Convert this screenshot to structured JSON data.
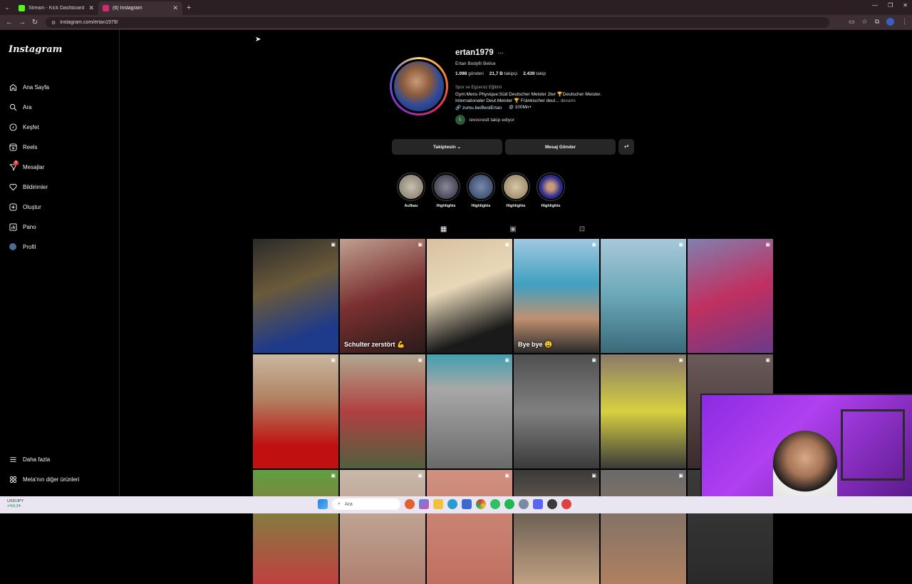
{
  "browser": {
    "tabs": [
      {
        "title": "Stream - Kick Dashboard",
        "favicon_color": "#53fc18",
        "active": false
      },
      {
        "title": "(6) Instagram",
        "favicon_color": "#d62976",
        "active": true
      }
    ],
    "url": "instagram.com/ertan1979/"
  },
  "sidebar": {
    "logo": "Instagram",
    "items": [
      {
        "label": "Ana Sayfa",
        "icon": "home-icon"
      },
      {
        "label": "Ara",
        "icon": "search-icon"
      },
      {
        "label": "Keşfet",
        "icon": "compass-icon"
      },
      {
        "label": "Reels",
        "icon": "reels-icon"
      },
      {
        "label": "Mesajlar",
        "icon": "messenger-icon",
        "badge": "6"
      },
      {
        "label": "Bildirimler",
        "icon": "heart-icon"
      },
      {
        "label": "Oluştur",
        "icon": "plus-square-icon"
      },
      {
        "label": "Pano",
        "icon": "dashboard-icon"
      },
      {
        "label": "Profil",
        "icon": "profile-avatar-icon"
      }
    ],
    "more": "Daha fazla",
    "meta": "Meta'nın diğer ürünleri"
  },
  "profile": {
    "username": "ertan1979",
    "full_name": "Ertan Bodyfit Belice",
    "posts": "1.098",
    "posts_label": "gönderi",
    "followers": "21,7 B",
    "followers_label": "takipçi",
    "following": "2.439",
    "following_label": "takip",
    "category": "Spor ve Egzersiz Eğitimi",
    "bio_line1": "Gym:Mens Physique:Süd Deutscher Meister 2ter 🏆Deutscher Meister.",
    "bio_line2": "Internationaler Deut.Meister 🏆 Fränkischer deut...",
    "bio_more": "devamı",
    "link1": "zumu.be/BestErtan",
    "link2": "100Mn+",
    "followed_by": "levocrestt takip ediyor"
  },
  "actions": {
    "following_button": "Takiptesin ⌄",
    "message_button": "Mesaj Gönder",
    "add_user": "+⁰"
  },
  "highlights": [
    {
      "label": "Aufbau",
      "color": "#9a9486"
    },
    {
      "label": "Highlights",
      "color": "#5a5a6a"
    },
    {
      "label": "Highlights",
      "color": "#4a5a7a"
    },
    {
      "label": "Highlights",
      "color": "#b0a08a"
    },
    {
      "label": "Highlights",
      "color": "#3a3a8a"
    }
  ],
  "posts": [
    {
      "bg": "linear-gradient(160deg,#2a2a2a,#6a5a3a 40%,#1e3a8a 80%)",
      "caption": ""
    },
    {
      "bg": "linear-gradient(160deg,#c0a090,#7a3030 50%,#2a1a1a)",
      "caption": "Schulter zerstört 💪"
    },
    {
      "bg": "linear-gradient(160deg,#d8c0a0,#e8d8b8 40%,#1a1a1a 80%)",
      "caption": ""
    },
    {
      "bg": "linear-gradient(180deg,#a0c8e0,#40a0c0 40%,#c09070 70%,#2a2a2a)",
      "caption": "Bye bye 😩"
    },
    {
      "bg": "linear-gradient(180deg,#a8c8d8,#6aa8b8 50%,#3a6a7a)",
      "caption": ""
    },
    {
      "bg": "linear-gradient(160deg,#8080b0,#c03060 50%,#6a3a8a)",
      "caption": ""
    },
    {
      "bg": "linear-gradient(180deg,#c8b8a0,#b08060 40%,#c01010 80%)",
      "caption": ""
    },
    {
      "bg": "linear-gradient(180deg,#b0a890,#b04040 50%,#506040)",
      "caption": ""
    },
    {
      "bg": "linear-gradient(180deg,#40a0b0,#a8a8a8 30%,#6a6a6a)",
      "caption": ""
    },
    {
      "bg": "linear-gradient(180deg,#505050,#808080 50%,#3a3a3a)",
      "caption": ""
    },
    {
      "bg": "linear-gradient(180deg,#8a7a6a,#d8d040 50%,#3a3a3a)",
      "caption": ""
    },
    {
      "bg": "linear-gradient(180deg,#6a5a5a,#3a2a2a)",
      "caption": ""
    },
    {
      "bg": "linear-gradient(180deg,#60a040,#c04040)",
      "caption": ""
    },
    {
      "bg": "linear-gradient(180deg,#c8b8a8,#b08070)",
      "caption": ""
    },
    {
      "bg": "linear-gradient(180deg,#d09080,#c07060)",
      "caption": ""
    },
    {
      "bg": "linear-gradient(180deg,#3a3a3a,#c0a080)",
      "caption": ""
    },
    {
      "bg": "linear-gradient(180deg,#6a6a6a,#b08060)",
      "caption": ""
    },
    {
      "bg": "linear-gradient(180deg,#3a3a3a,#2a2a2a)",
      "caption": ""
    }
  ],
  "taskbar": {
    "ticker_symbol": "USD/JPY",
    "ticker_change": "+%0,24",
    "search": "Ara"
  }
}
